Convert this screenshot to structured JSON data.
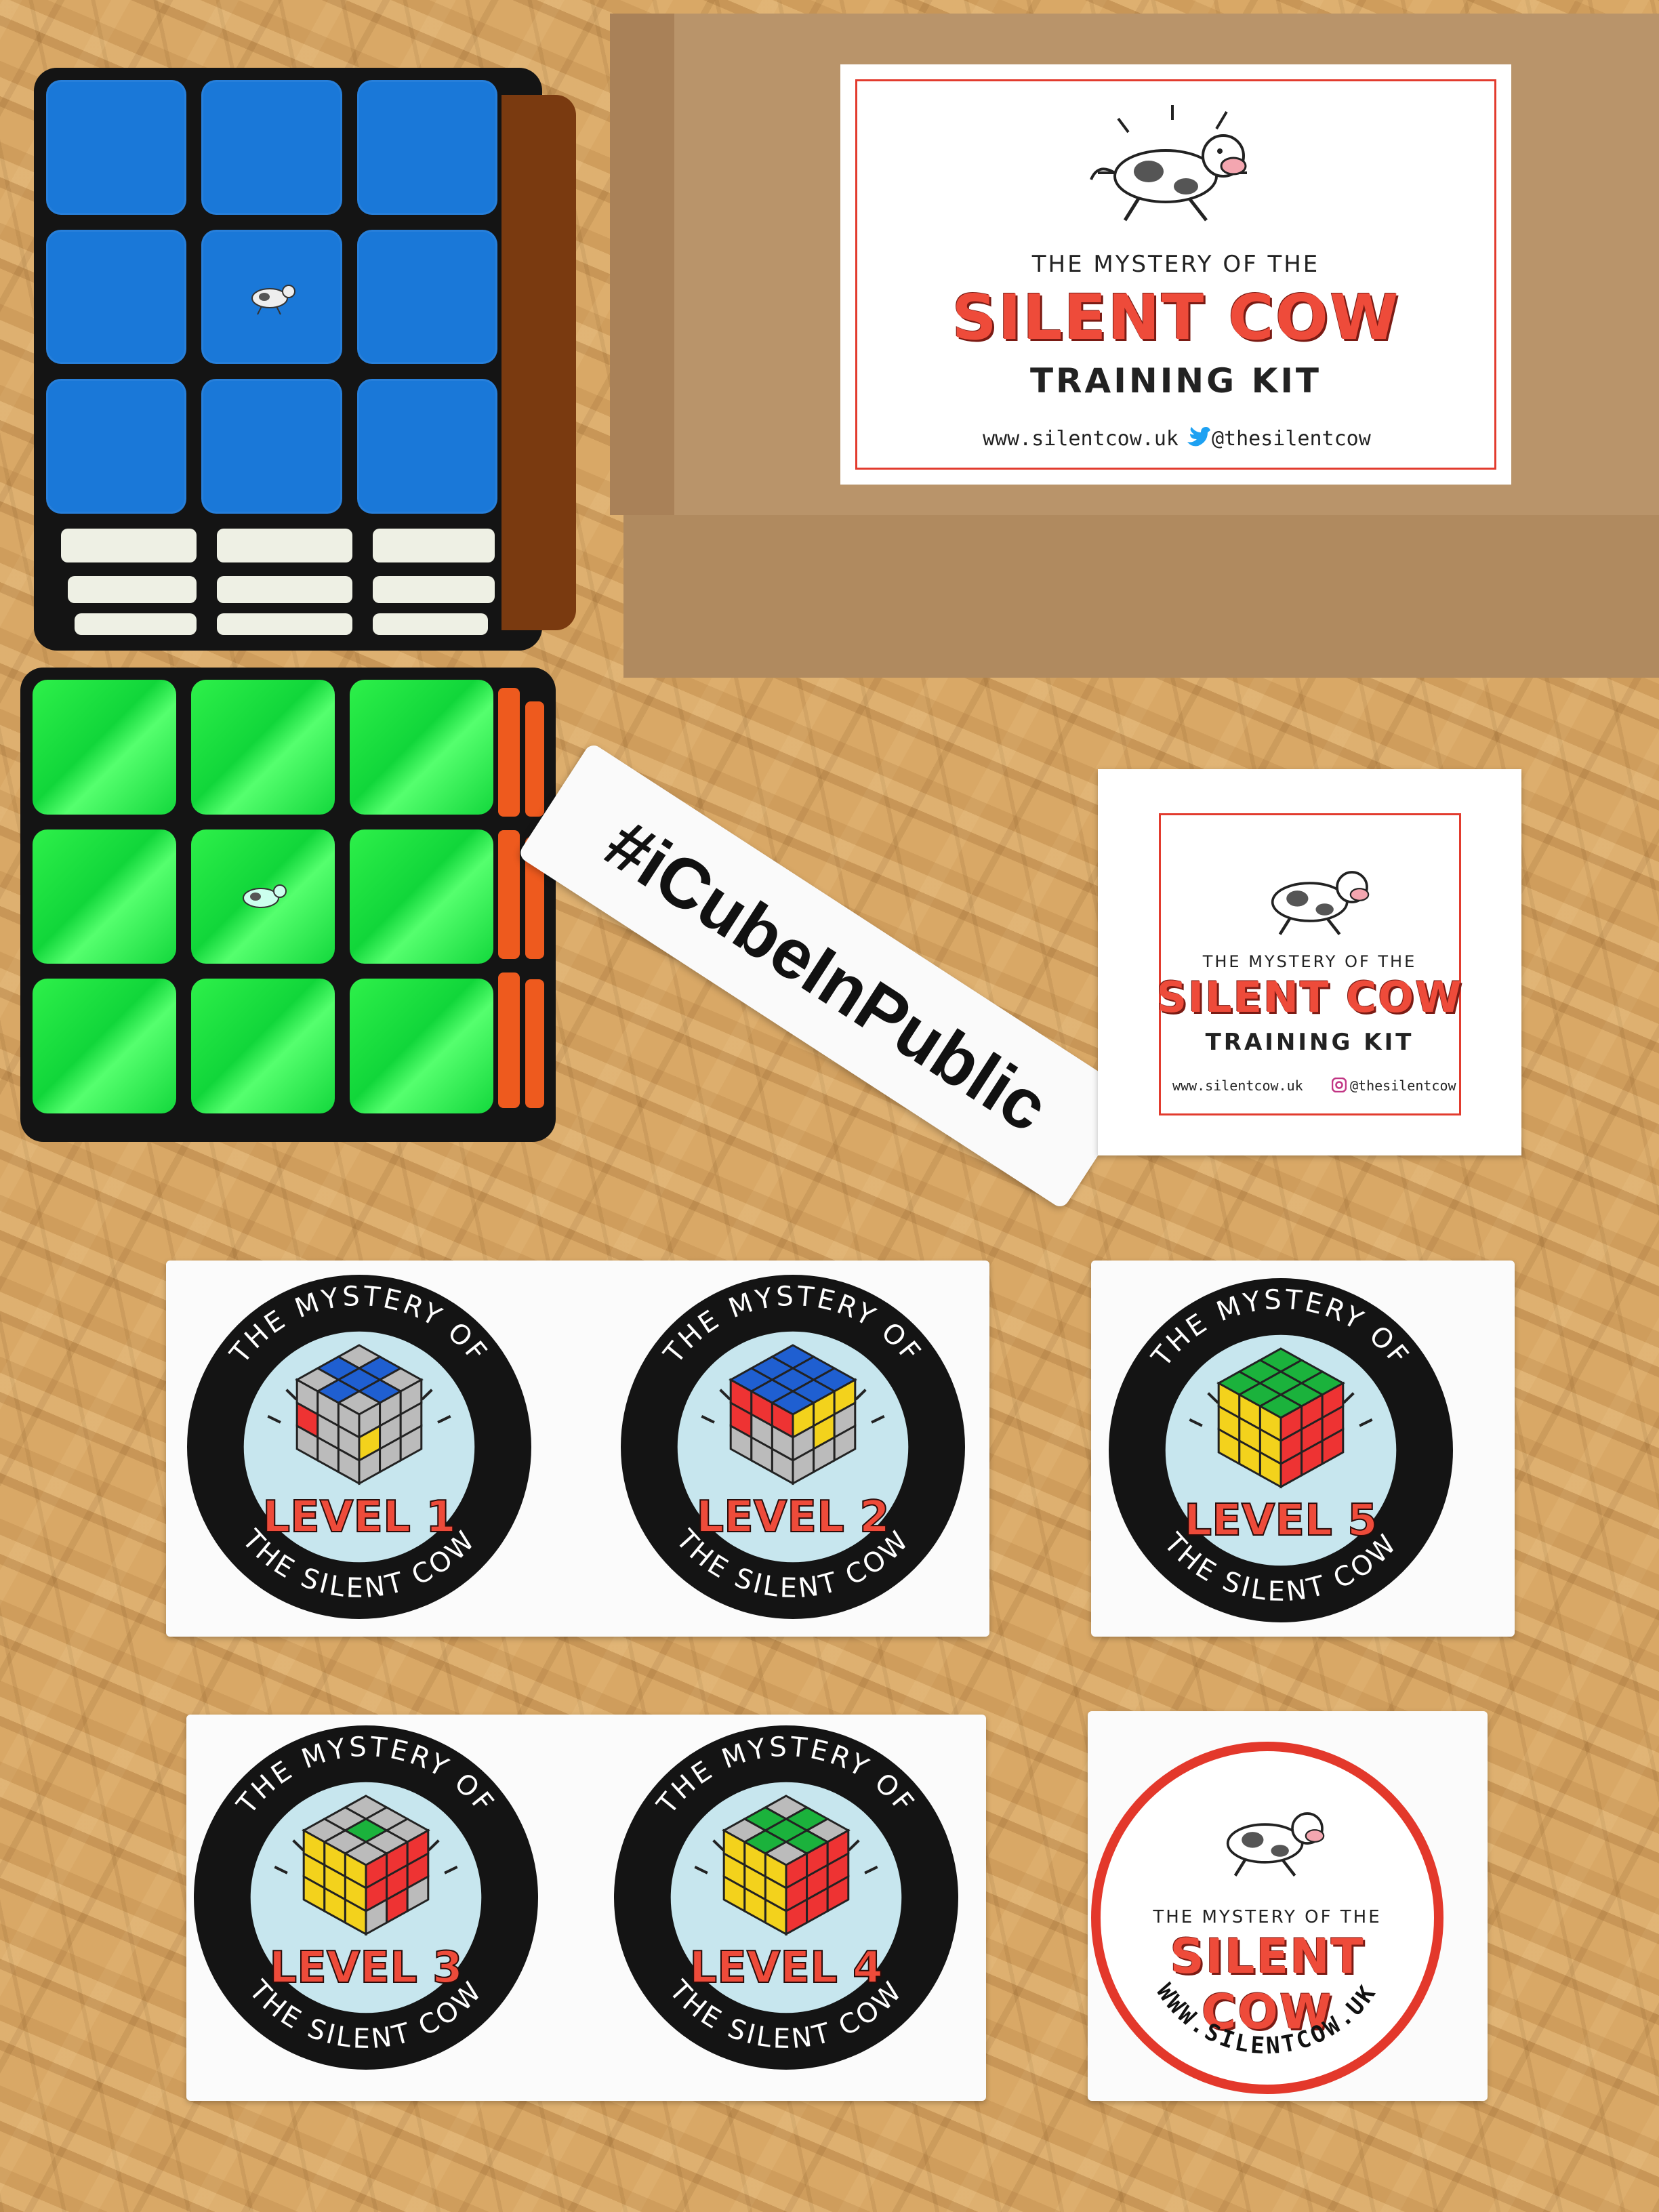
{
  "box_label": {
    "line1": "THE MYSTERY OF THE",
    "line2": "SILENT COW",
    "line3": "TRAINING KIT",
    "website": "www.silentcow.uk",
    "social": "@thesilentcow",
    "social_icon": "twitter-bird-icon"
  },
  "square_sticker": {
    "line1": "THE MYSTERY OF THE",
    "line2": "SILENT COW",
    "line3": "TRAINING KIT",
    "website": "www.silentcow.uk",
    "social": "@thesilentcow",
    "social_icon": "instagram-icon"
  },
  "hashtag_sticker": {
    "text": "#iCubeInPublic"
  },
  "level_stickers": {
    "top_text": "THE MYSTERY OF",
    "bottom_text": "THE SILENT COW",
    "levels": [
      "LEVEL 1",
      "LEVEL 2",
      "LEVEL 5",
      "LEVEL 3",
      "LEVEL 4"
    ]
  },
  "round_sticker": {
    "line1": "THE MYSTERY OF THE",
    "line2": "SILENT COW",
    "website": "WWW.SILENTCOW.UK"
  },
  "colors": {
    "brand_red": "#ee4b3a",
    "cube_blue": "#1a78d8",
    "cube_green": "#18e040",
    "cube_orange": "#ee5a1e",
    "badge_light_blue": "#c7e6ee"
  }
}
